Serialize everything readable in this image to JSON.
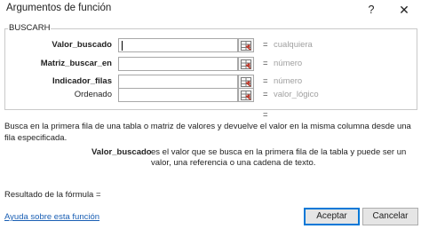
{
  "window": {
    "title": "Argumentos de función",
    "help_glyph": "?",
    "close_glyph": "✕"
  },
  "function_group": {
    "name": "BUSCARH"
  },
  "arguments": [
    {
      "label": "Valor_buscado",
      "bold": true,
      "value": "cualquiera",
      "equals": "="
    },
    {
      "label": "Matriz_buscar_en",
      "bold": true,
      "value": "número",
      "equals": "="
    },
    {
      "label": "Indicador_filas",
      "bold": true,
      "value": "número",
      "equals": "="
    },
    {
      "label": "Ordenado",
      "bold": false,
      "value": "valor_lógico",
      "equals": "="
    }
  ],
  "result_equals": "=",
  "description": "Busca en la primera fila de una tabla o matriz de valores y devuelve el valor en la misma columna desde una fila especificada.",
  "param_help": {
    "name": "Valor_buscado",
    "text": "es el valor que se busca en la primera fila de la tabla y puede ser un valor, una referencia o una cadena de texto."
  },
  "formula_result_label": "Resultado de la fórmula =",
  "help_link": "Ayuda sobre esta función",
  "buttons": {
    "accept": "Aceptar",
    "cancel": "Cancelar"
  },
  "icons": {
    "ref_button": "range-select-icon",
    "help": "help-icon",
    "close": "close-icon"
  },
  "colors": {
    "link": "#1a5fb4",
    "value_hint": "#a0a0a0",
    "default_button_border": "#0078d7"
  }
}
